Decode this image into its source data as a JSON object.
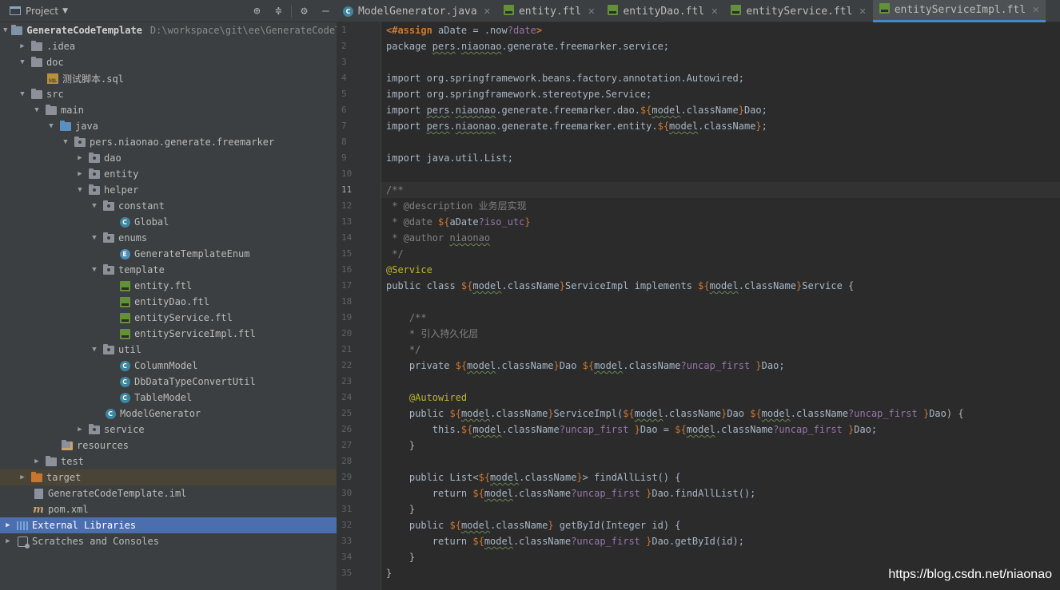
{
  "project_panel": {
    "title": "Project",
    "tree": [
      {
        "label": "GenerateCodeTemplate",
        "path": "D:\\workspace\\git\\ee\\GenerateCodeT"
      },
      {
        "label": ".idea"
      },
      {
        "label": "doc"
      },
      {
        "label": "测试脚本.sql"
      },
      {
        "label": "src"
      },
      {
        "label": "main"
      },
      {
        "label": "java"
      },
      {
        "label": "pers.niaonao.generate.freemarker"
      },
      {
        "label": "dao"
      },
      {
        "label": "entity"
      },
      {
        "label": "helper"
      },
      {
        "label": "constant"
      },
      {
        "label": "Global"
      },
      {
        "label": "enums"
      },
      {
        "label": "GenerateTemplateEnum"
      },
      {
        "label": "template"
      },
      {
        "label": "entity.ftl"
      },
      {
        "label": "entityDao.ftl"
      },
      {
        "label": "entityService.ftl"
      },
      {
        "label": "entityServiceImpl.ftl"
      },
      {
        "label": "util"
      },
      {
        "label": "ColumnModel"
      },
      {
        "label": "DbDataTypeConvertUtil"
      },
      {
        "label": "TableModel"
      },
      {
        "label": "ModelGenerator"
      },
      {
        "label": "service"
      },
      {
        "label": "resources"
      },
      {
        "label": "test"
      },
      {
        "label": "target"
      },
      {
        "label": "GenerateCodeTemplate.iml"
      },
      {
        "label": "pom.xml"
      },
      {
        "label": "External Libraries"
      },
      {
        "label": "Scratches and Consoles"
      }
    ]
  },
  "tabs": [
    {
      "label": "ModelGenerator.java"
    },
    {
      "label": "entity.ftl"
    },
    {
      "label": "entityDao.ftl"
    },
    {
      "label": "entityService.ftl"
    },
    {
      "label": "entityServiceImpl.ftl"
    }
  ],
  "editor": {
    "current_line": 11,
    "lines": [
      "<#assign aDate = .now?date>",
      "package pers.niaonao.generate.freemarker.service;",
      "",
      "import org.springframework.beans.factory.annotation.Autowired;",
      "import org.springframework.stereotype.Service;",
      "import pers.niaonao.generate.freemarker.dao.${model.className}Dao;",
      "import pers.niaonao.generate.freemarker.entity.${model.className};",
      "",
      "import java.util.List;",
      "",
      "/**",
      " * @description 业务层实现",
      " * @date ${aDate?iso_utc}",
      " * @author niaonao",
      " */",
      "@Service",
      "public class ${model.className}ServiceImpl implements ${model.className}Service {",
      "",
      "    /**",
      "    * 引入持久化层",
      "    */",
      "    private ${model.className}Dao ${model.className?uncap_first }Dao;",
      "",
      "    @Autowired",
      "    public ${model.className}ServiceImpl(${model.className}Dao ${model.className?uncap_first }Dao) {",
      "        this.${model.className?uncap_first }Dao = ${model.className?uncap_first }Dao;",
      "    }",
      "",
      "    public List<${model.className}> findAllList() {",
      "        return ${model.className?uncap_first }Dao.findAllList();",
      "    }",
      "    public ${model.className} getById(Integer id) {",
      "        return ${model.className?uncap_first }Dao.getById(id);",
      "    }",
      "}"
    ]
  },
  "watermark": "https://blog.csdn.net/niaonao"
}
